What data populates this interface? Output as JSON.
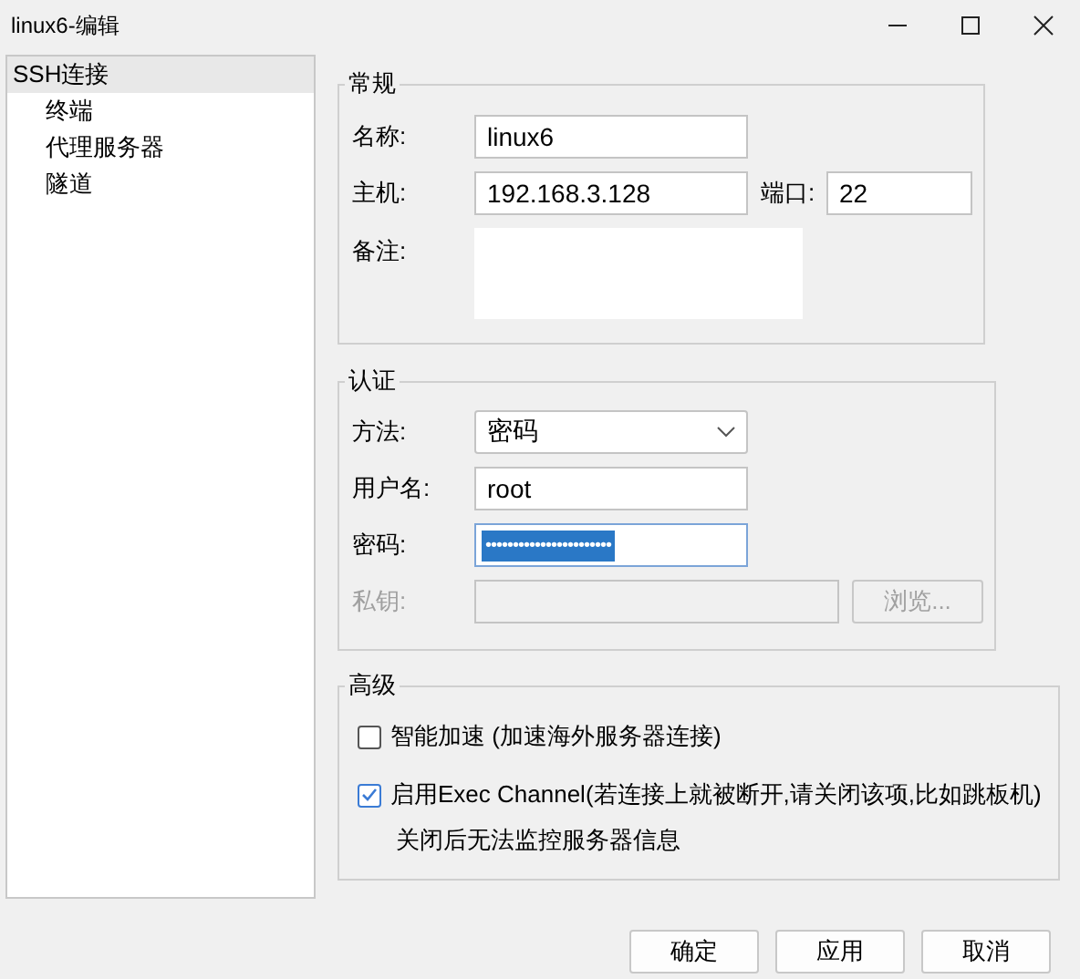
{
  "window": {
    "title": "linux6-编辑"
  },
  "sidebar": {
    "items": [
      {
        "label": "SSH连接",
        "selected": true,
        "children": [
          {
            "label": "终端",
            "selected": false
          },
          {
            "label": "代理服务器",
            "selected": false
          },
          {
            "label": "隧道",
            "selected": false
          }
        ]
      }
    ]
  },
  "general": {
    "title": "常规",
    "name": {
      "label": "名称:",
      "value": "linux6"
    },
    "host": {
      "label": "主机:",
      "value": "192.168.3.128"
    },
    "port": {
      "label": "端口:",
      "value": "22"
    },
    "note": {
      "label": "备注:"
    }
  },
  "auth": {
    "title": "认证",
    "method": {
      "label": "方法:",
      "value": "密码"
    },
    "username": {
      "label": "用户名:",
      "value": "root"
    },
    "password": {
      "label": "密码:",
      "value": "•••••••••••••••••••••••",
      "text_selected": true
    },
    "private_key": {
      "label": "私钥:",
      "disabled": true,
      "browse_button": "浏览..."
    }
  },
  "advanced": {
    "title": "高级",
    "options": [
      {
        "label": "智能加速 (加速海外服务器连接)",
        "checked": false
      },
      {
        "label": "启用Exec Channel(若连接上就被断开,请关闭该项,比如跳板机)",
        "checked": true
      }
    ],
    "note": "关闭后无法监控服务器信息"
  },
  "buttons": [
    "确定",
    "应用",
    "取消"
  ]
}
